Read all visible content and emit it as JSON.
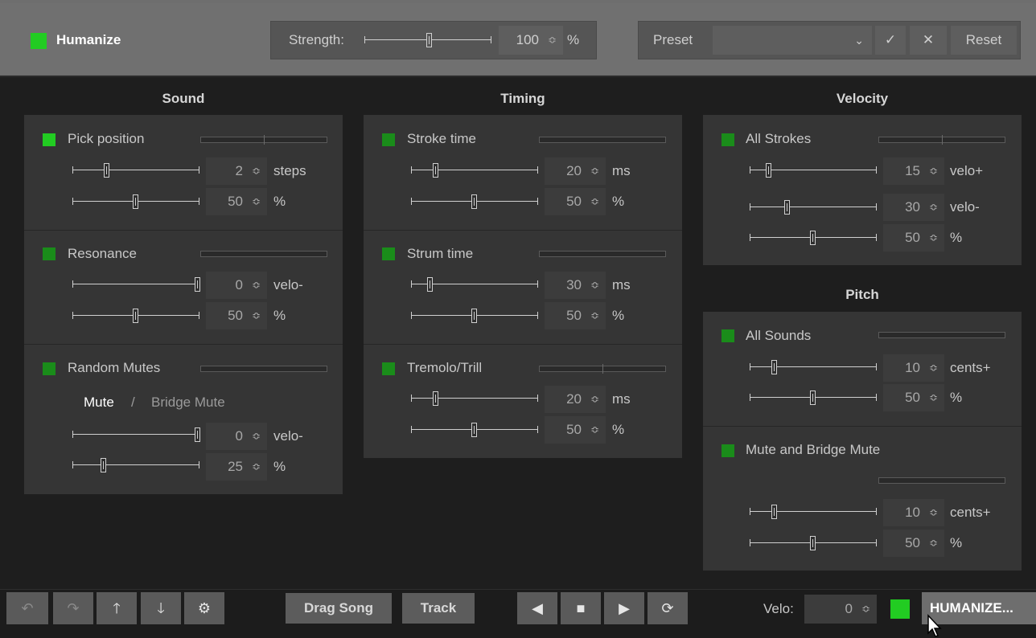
{
  "header": {
    "title": "Humanize",
    "strength_label": "Strength:",
    "strength_value": "100",
    "strength_unit": "%",
    "strength_level": 0.5,
    "preset_label": "Preset",
    "preset_value": "",
    "reset_label": "Reset",
    "spin_glyph": "≎"
  },
  "sections": {
    "sound": "Sound",
    "timing": "Timing",
    "velocity": "Velocity",
    "pitch": "Pitch"
  },
  "sound": {
    "pick": {
      "label": "Pick position",
      "v1": "2",
      "u1": "steps",
      "v2": "50",
      "u2": "%"
    },
    "resonance": {
      "label": "Resonance",
      "v1": "0",
      "u1": "velo-",
      "v2": "50",
      "u2": "%"
    },
    "mutes": {
      "label": "Random Mutes",
      "mute": "Mute",
      "slash": "/",
      "bridge": "Bridge Mute",
      "v1": "0",
      "u1": "velo-",
      "v2": "25",
      "u2": "%"
    }
  },
  "timing": {
    "stroke": {
      "label": "Stroke time",
      "v1": "20",
      "u1": "ms",
      "v2": "50",
      "u2": "%"
    },
    "strum": {
      "label": "Strum time",
      "v1": "30",
      "u1": "ms",
      "v2": "50",
      "u2": "%"
    },
    "tremolo": {
      "label": "Tremolo/Trill",
      "v1": "20",
      "u1": "ms",
      "v2": "50",
      "u2": "%"
    }
  },
  "velocity": {
    "all": {
      "label": "All Strokes",
      "v1": "15",
      "u1": "velo+",
      "v2": "30",
      "u2": "velo-",
      "v3": "50",
      "u3": "%"
    }
  },
  "pitch": {
    "sounds": {
      "label": "All Sounds",
      "v1": "10",
      "u1": "cents+",
      "v2": "50",
      "u2": "%"
    },
    "mute": {
      "label": "Mute and Bridge Mute",
      "v1": "10",
      "u1": "cents+",
      "v2": "50",
      "u2": "%"
    }
  },
  "bottom": {
    "drag_song": "Drag Song",
    "track": "Track",
    "velo_label": "Velo:",
    "velo_value": "0",
    "humanize_btn": "HUMANIZE..."
  },
  "colors": {
    "active_green": "#22cc22",
    "dim_green": "#1a8c1a"
  }
}
